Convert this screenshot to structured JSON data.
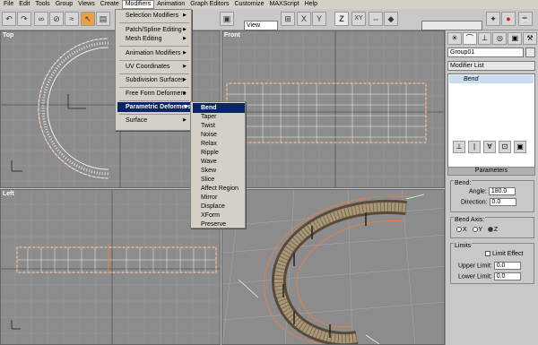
{
  "menubar": [
    "File",
    "Edit",
    "Tools",
    "Group",
    "Views",
    "Create",
    "Modifiers",
    "Animation",
    "Graph Editors",
    "Customize",
    "MAXScript",
    "Help"
  ],
  "toolbar": {
    "view_dropdown": "View",
    "z_button": "Z",
    "xy_button": "XY"
  },
  "viewports": {
    "top": "Top",
    "front": "Front",
    "left": "Left",
    "perspective": "ective"
  },
  "modifiers_menu": [
    "Selection Modifiers",
    "Patch/Spline Editing",
    "Mesh Editing",
    "Animation Modifiers",
    "UV Coordinates",
    "Subdivision Surfaces",
    "Free Form Deformers",
    "Parametric Deformers",
    "Surface"
  ],
  "parametric_submenu": [
    "Bend",
    "Taper",
    "Twist",
    "Noise",
    "Relax",
    "Ripple",
    "Wave",
    "Skew",
    "Slice",
    "Affect Region",
    "Mirror",
    "Displace",
    "XForm",
    "Preserve"
  ],
  "panel": {
    "object_name": "Group01",
    "modifier_list": "Modifier List",
    "stack_item": "Bend",
    "parameters_title": "Parameters",
    "bend_group": "Bend:",
    "angle_label": "Angle:",
    "angle_value": "180.0",
    "direction_label": "Direction:",
    "direction_value": "0.0",
    "bend_axis_label": "Bend Axis:",
    "axis_x": "X",
    "axis_y": "Y",
    "axis_z": "Z",
    "limits_label": "Limits",
    "limit_effect": "Limit Effect",
    "upper_limit_label": "Upper Limit:",
    "upper_limit_value": "0.0",
    "lower_limit_label": "Lower Limit:",
    "lower_limit_value": "0.0"
  }
}
